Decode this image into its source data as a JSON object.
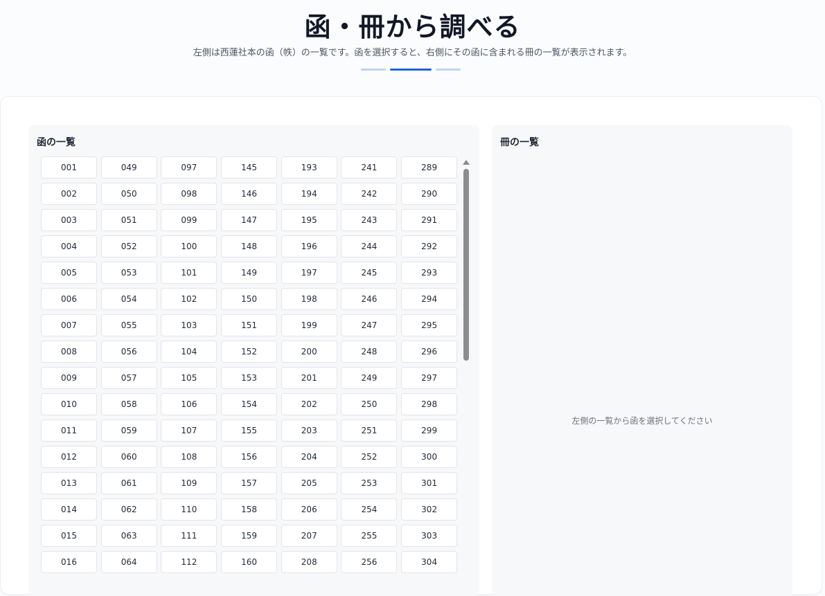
{
  "header": {
    "title": "函・冊から調べる",
    "subtitle": "左側は西蓮社本の函（帙）の一覧です。函を選択すると、右側にその函に含まれる冊の一覧が表示されます。"
  },
  "left_panel": {
    "title": "函の一覧",
    "boxes": [
      [
        "001",
        "049",
        "097",
        "145",
        "193",
        "241",
        "289"
      ],
      [
        "002",
        "050",
        "098",
        "146",
        "194",
        "242",
        "290"
      ],
      [
        "003",
        "051",
        "099",
        "147",
        "195",
        "243",
        "291"
      ],
      [
        "004",
        "052",
        "100",
        "148",
        "196",
        "244",
        "292"
      ],
      [
        "005",
        "053",
        "101",
        "149",
        "197",
        "245",
        "293"
      ],
      [
        "006",
        "054",
        "102",
        "150",
        "198",
        "246",
        "294"
      ],
      [
        "007",
        "055",
        "103",
        "151",
        "199",
        "247",
        "295"
      ],
      [
        "008",
        "056",
        "104",
        "152",
        "200",
        "248",
        "296"
      ],
      [
        "009",
        "057",
        "105",
        "153",
        "201",
        "249",
        "297"
      ],
      [
        "010",
        "058",
        "106",
        "154",
        "202",
        "250",
        "298"
      ],
      [
        "011",
        "059",
        "107",
        "155",
        "203",
        "251",
        "299"
      ],
      [
        "012",
        "060",
        "108",
        "156",
        "204",
        "252",
        "300"
      ],
      [
        "013",
        "061",
        "109",
        "157",
        "205",
        "253",
        "301"
      ],
      [
        "014",
        "062",
        "110",
        "158",
        "206",
        "254",
        "302"
      ],
      [
        "015",
        "063",
        "111",
        "159",
        "207",
        "255",
        "303"
      ],
      [
        "016",
        "064",
        "112",
        "160",
        "208",
        "256",
        "304"
      ]
    ]
  },
  "right_panel": {
    "title": "冊の一覧",
    "empty_message": "左側の一覧から函を選択してください"
  },
  "colors": {
    "accent": "#1d62d8",
    "accent_light": "#bfd2f5"
  }
}
